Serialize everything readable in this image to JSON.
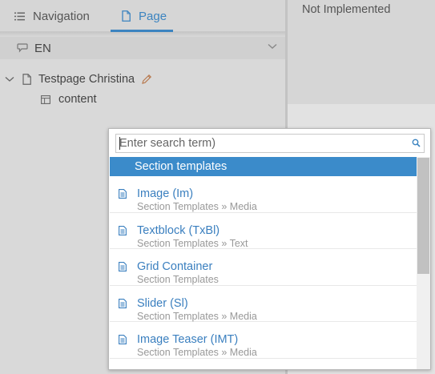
{
  "tabs": [
    {
      "label": "Navigation",
      "icon": "list-icon",
      "active": false
    },
    {
      "label": "Page",
      "icon": "page-icon",
      "active": true
    }
  ],
  "language": {
    "label": "EN",
    "icon": "speech-bubble-icon"
  },
  "tree": {
    "root": {
      "label": "Testpage Christina",
      "icon": "page-icon"
    },
    "child": {
      "label": "content",
      "icon": "layout-icon"
    }
  },
  "right_panel": {
    "status": "Not Implemented"
  },
  "popup": {
    "search_placeholder": "Enter search term)",
    "group": "Section templates",
    "items": [
      {
        "title": "Image (Im)",
        "path": "Section Templates » Media"
      },
      {
        "title": "Textblock (TxBl)",
        "path": "Section Templates » Text"
      },
      {
        "title": "Grid Container",
        "path": "Section Templates"
      },
      {
        "title": "Slider (Sl)",
        "path": "Section Templates » Media"
      },
      {
        "title": "Image Teaser (IMT)",
        "path": "Section Templates » Media"
      }
    ]
  },
  "colors": {
    "accent": "#3c84c0",
    "selected_bg": "#3b8bca",
    "item_title": "#3a7fbf",
    "item_path": "#999999"
  }
}
